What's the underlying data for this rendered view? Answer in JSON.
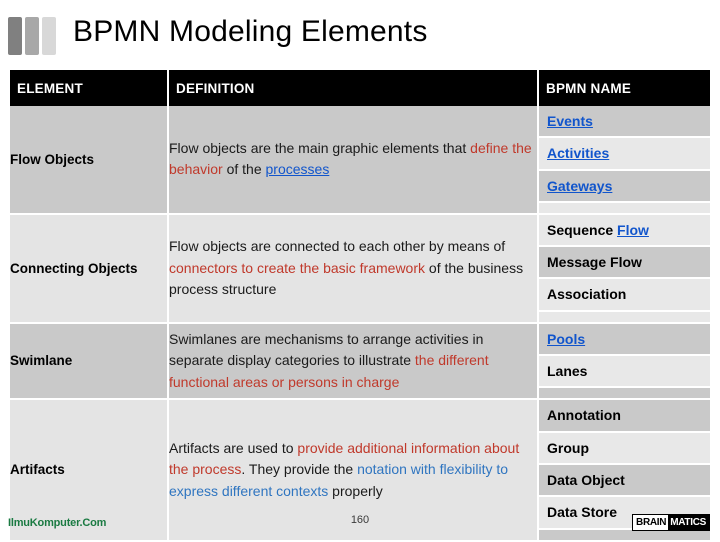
{
  "title": "BPMN Modeling Elements",
  "decor_bars": [
    "#808080",
    "#a8a8a8",
    "#d8d8d8"
  ],
  "colors": {
    "header_bg": "#000000",
    "header_fg": "#ffffff",
    "row_dark": "#c9c9c9",
    "row_light": "#e4e4e4",
    "accent_red": "#c0392b",
    "accent_blue": "#2f75c0",
    "link_blue": "#1155cc",
    "watermark_green": "#1a7a42"
  },
  "table": {
    "headers": {
      "element": "ELEMENT",
      "definition": "DEFINITION",
      "bpmn_name": "BPMN NAME"
    },
    "rows": [
      {
        "element": "Flow Objects",
        "definition_parts": [
          {
            "text": "Flow objects are the main graphic elements that ",
            "style": "plain"
          },
          {
            "text": "define the behavior",
            "style": "red"
          },
          {
            "text": " of the ",
            "style": "plain"
          },
          {
            "text": "processes",
            "style": "link"
          }
        ],
        "names": [
          {
            "text": "Events",
            "style": "link",
            "shade": "a"
          },
          {
            "text": "Activities",
            "style": "link",
            "shade": "b"
          },
          {
            "text": "Gateways",
            "style": "link",
            "shade": "a"
          }
        ]
      },
      {
        "element": "Connecting Objects",
        "definition_parts": [
          {
            "text": "Flow objects are connected to each other by means of ",
            "style": "plain"
          },
          {
            "text": "connectors to create the basic framework",
            "style": "red"
          },
          {
            "text": " of the business process structure",
            "style": "plain"
          }
        ],
        "names": [
          {
            "text": "Sequence ",
            "style": "plain",
            "suffix": "Flow",
            "suffix_style": "link",
            "shade": "b"
          },
          {
            "text": "Message Flow",
            "style": "plain",
            "shade": "a"
          },
          {
            "text": "Association",
            "style": "plain",
            "shade": "b"
          }
        ]
      },
      {
        "element": "Swimlane",
        "definition_parts": [
          {
            "text": "Swimlanes are mechanisms to arrange activities in separate display categories to illustrate ",
            "style": "plain"
          },
          {
            "text": "the different functional areas or persons in charge",
            "style": "red"
          }
        ],
        "names": [
          {
            "text": "Pools",
            "style": "link",
            "shade": "a"
          },
          {
            "text": "Lanes",
            "style": "plain",
            "shade": "b"
          }
        ]
      },
      {
        "element": "Artifacts",
        "definition_parts": [
          {
            "text": "Artifacts are used to ",
            "style": "plain"
          },
          {
            "text": "provide additional information about the process",
            "style": "red"
          },
          {
            "text": ". They provide the ",
            "style": "plain"
          },
          {
            "text": "notation with flexibility to express different contexts",
            "style": "blue"
          },
          {
            "text": " properly",
            "style": "plain"
          }
        ],
        "names": [
          {
            "text": "Annotation",
            "style": "plain",
            "shade": "a"
          },
          {
            "text": "Group",
            "style": "plain",
            "shade": "b"
          },
          {
            "text": "Data Object",
            "style": "plain",
            "shade": "a"
          },
          {
            "text": "Data Store",
            "style": "plain",
            "shade": "b"
          }
        ]
      }
    ]
  },
  "footer": {
    "watermark": "IlmuKomputer.Com",
    "page_number": "160",
    "brand_first": "BRAIN",
    "brand_second": "MATICS"
  }
}
